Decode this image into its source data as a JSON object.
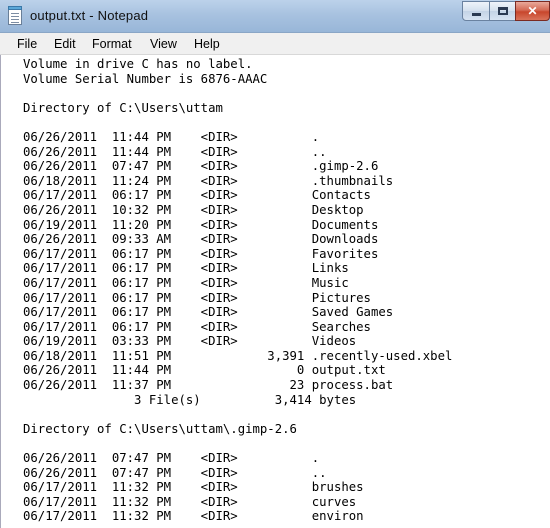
{
  "window": {
    "title": "output.txt - Notepad"
  },
  "controls": {
    "minimize_glyph": "",
    "maximize_glyph": "",
    "close_glyph": "✕"
  },
  "menu": {
    "file": "File",
    "edit": "Edit",
    "format": "Format",
    "view": "View",
    "help": "Help"
  },
  "document": {
    "lines": [
      "Volume in drive C has no label.",
      "Volume Serial Number is 6876-AAAC",
      "",
      "Directory of C:\\Users\\uttam",
      "",
      "06/26/2011  11:44 PM    <DIR>          .",
      "06/26/2011  11:44 PM    <DIR>          ..",
      "06/26/2011  07:47 PM    <DIR>          .gimp-2.6",
      "06/18/2011  11:24 PM    <DIR>          .thumbnails",
      "06/17/2011  06:17 PM    <DIR>          Contacts",
      "06/26/2011  10:32 PM    <DIR>          Desktop",
      "06/19/2011  11:20 PM    <DIR>          Documents",
      "06/26/2011  09:33 AM    <DIR>          Downloads",
      "06/17/2011  06:17 PM    <DIR>          Favorites",
      "06/17/2011  06:17 PM    <DIR>          Links",
      "06/17/2011  06:17 PM    <DIR>          Music",
      "06/17/2011  06:17 PM    <DIR>          Pictures",
      "06/17/2011  06:17 PM    <DIR>          Saved Games",
      "06/17/2011  06:17 PM    <DIR>          Searches",
      "06/19/2011  03:33 PM    <DIR>          Videos",
      "06/18/2011  11:51 PM             3,391 .recently-used.xbel",
      "06/26/2011  11:44 PM                 0 output.txt",
      "06/26/2011  11:37 PM                23 process.bat",
      "               3 File(s)          3,414 bytes",
      "",
      "Directory of C:\\Users\\uttam\\.gimp-2.6",
      "",
      "06/26/2011  07:47 PM    <DIR>          .",
      "06/26/2011  07:47 PM    <DIR>          ..",
      "06/17/2011  11:32 PM    <DIR>          brushes",
      "06/17/2011  11:32 PM    <DIR>          curves",
      "06/17/2011  11:32 PM    <DIR>          environ"
    ]
  }
}
